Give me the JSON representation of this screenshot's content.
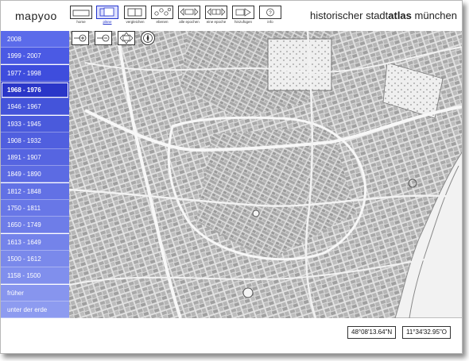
{
  "app": {
    "logo": "mapyoo",
    "title_prefix": "historischer stadt",
    "title_bold": "atlas",
    "title_suffix": " münchen"
  },
  "nav": [
    {
      "label": "home",
      "icon": "home-icon"
    },
    {
      "label": "pläne",
      "icon": "plans-icon"
    },
    {
      "label": "vergleichen",
      "icon": "compare-icon"
    },
    {
      "label": "ebenen",
      "icon": "layers-icon"
    },
    {
      "label": "alle epochen",
      "icon": "all-epochs-icon"
    },
    {
      "label": "eine epoche",
      "icon": "one-epoch-icon"
    },
    {
      "label": "hinzufügen",
      "icon": "add-icon"
    },
    {
      "label": "info",
      "icon": "info-icon"
    }
  ],
  "epochs": [
    {
      "label": "2008",
      "color": "#5b6bea"
    },
    {
      "label": "1999 - 2007",
      "color": "#4b5ae4"
    },
    {
      "label": "1977 - 1998",
      "color": "#3e4ddd"
    },
    {
      "label": "1968 - 1976",
      "color": "#2a36c8",
      "active": true
    },
    {
      "label": "1946 - 1967",
      "color": "#4454da"
    },
    {
      "label": "1933 - 1945",
      "color": "#4a5adc"
    },
    {
      "label": "1908 - 1932",
      "color": "#505fdf"
    },
    {
      "label": "1891 - 1907",
      "color": "#5665e1"
    },
    {
      "label": "1849 - 1890",
      "color": "#5c6be3"
    },
    {
      "label": "1812 - 1848",
      "color": "#6271e5"
    },
    {
      "label": "1750 - 1811",
      "color": "#6877e7"
    },
    {
      "label": "1650 - 1749",
      "color": "#6e7de8"
    },
    {
      "label": "1613 - 1649",
      "color": "#7483ea"
    },
    {
      "label": "1500 - 1612",
      "color": "#7a89eb"
    },
    {
      "label": "1158 - 1500",
      "color": "#808fed"
    },
    {
      "label": "früher",
      "color": "#8795ee"
    },
    {
      "label": "unter der erde",
      "color": "#8d9bf0"
    }
  ],
  "tools": [
    "zoom-in-icon",
    "zoom-out-icon",
    "pan-arrows-icon",
    "compass-icon"
  ],
  "coords": {
    "latitude": "48°08'13.64\"N",
    "longitude": "11°34'32.95\"O"
  }
}
